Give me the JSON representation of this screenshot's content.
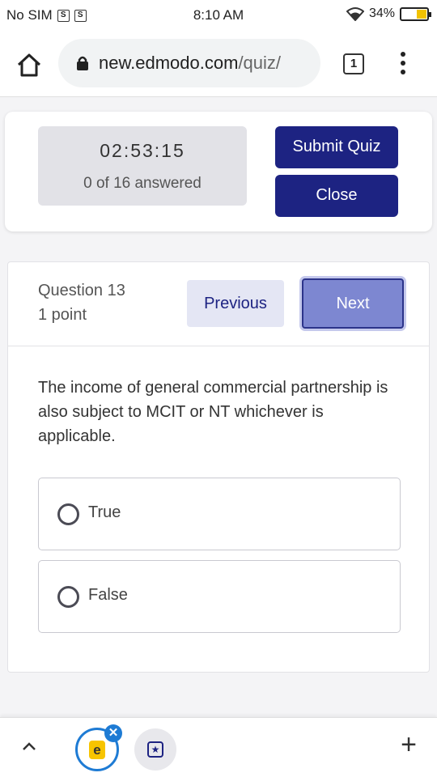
{
  "status_bar": {
    "carrier": "No SIM",
    "time": "8:10 AM",
    "battery": "34%"
  },
  "browser": {
    "url_host": "new.edmodo.com",
    "url_path": "/quiz/",
    "tab_count": "1"
  },
  "quiz_panel": {
    "timer": "02:53:15",
    "answered": "0 of 16 answered",
    "submit_label": "Submit Quiz",
    "close_label": "Close"
  },
  "question": {
    "number": "Question 13",
    "points": "1 point",
    "prev_label": "Previous",
    "next_label": "Next",
    "text": "The income of general commercial partnership is also subject to MCIT or NT whichever is applicable.",
    "options": [
      {
        "label": "True"
      },
      {
        "label": "False"
      }
    ]
  },
  "bottom_bar": {
    "edmodo_tab_letter": "e"
  },
  "colors": {
    "primary": "#1d2382",
    "next_button": "#7d87d1",
    "accent_blue": "#1e7bd4",
    "edmodo_yellow": "#f7c400"
  }
}
